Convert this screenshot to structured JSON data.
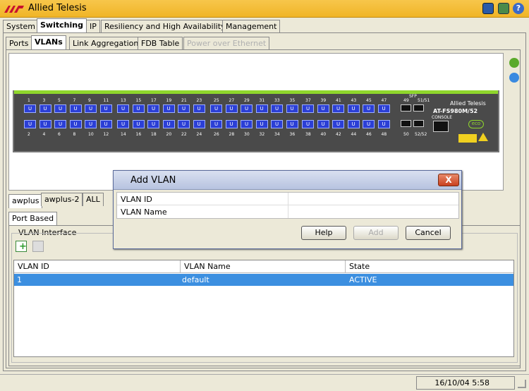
{
  "app": {
    "title": "Allied Telesis"
  },
  "main_tabs": [
    "System",
    "Switching",
    "IP",
    "Resiliency and High Availability",
    "Management"
  ],
  "sub_tabs": [
    "Ports",
    "VLANs",
    "Link Aggregation",
    "FDB Table",
    "Power over Ethernet"
  ],
  "switch": {
    "brand": "Allied Telesis",
    "model": "AT-FS980M/52",
    "console_label": "CONSOLE",
    "sfp_label": "SFP",
    "top_port_numbers": [
      "1",
      "3",
      "5",
      "7",
      "9",
      "11",
      "13",
      "15",
      "17",
      "19",
      "21",
      "23",
      "25",
      "27",
      "29",
      "31",
      "33",
      "35",
      "37",
      "39",
      "41",
      "43",
      "45",
      "47"
    ],
    "bottom_port_numbers": [
      "2",
      "4",
      "6",
      "8",
      "10",
      "12",
      "14",
      "16",
      "18",
      "20",
      "22",
      "24",
      "26",
      "28",
      "30",
      "32",
      "34",
      "36",
      "38",
      "40",
      "42",
      "44",
      "46",
      "48"
    ],
    "sfp_top": [
      "49",
      "51/51"
    ],
    "sfp_bottom": [
      "50",
      "52/52"
    ],
    "port_glyph": "U",
    "eco_label": "eco"
  },
  "vlan_tabs": [
    "awplus",
    "awplus-2",
    "ALL"
  ],
  "port_based_tab": "Port Based",
  "vlan_interface": {
    "label": "VLAN Interface",
    "columns": [
      "VLAN ID",
      "VLAN Name",
      "State"
    ],
    "rows": [
      {
        "id": "1",
        "name": "default",
        "state": "ACTIVE"
      }
    ]
  },
  "status": {
    "datetime": "16/10/04 5:58"
  },
  "dialog": {
    "title": "Add VLAN",
    "close": "X",
    "fields": [
      {
        "label": "VLAN ID",
        "value": ""
      },
      {
        "label": "VLAN Name",
        "value": ""
      }
    ],
    "help": "Help",
    "add": "Add",
    "cancel": "Cancel"
  },
  "colors": {
    "titlebar": "#f0b527",
    "selection": "#3c8fe0",
    "port": "#2b3fd6",
    "chassis": "#4a4a4a",
    "accent_green": "#8fd62c"
  }
}
